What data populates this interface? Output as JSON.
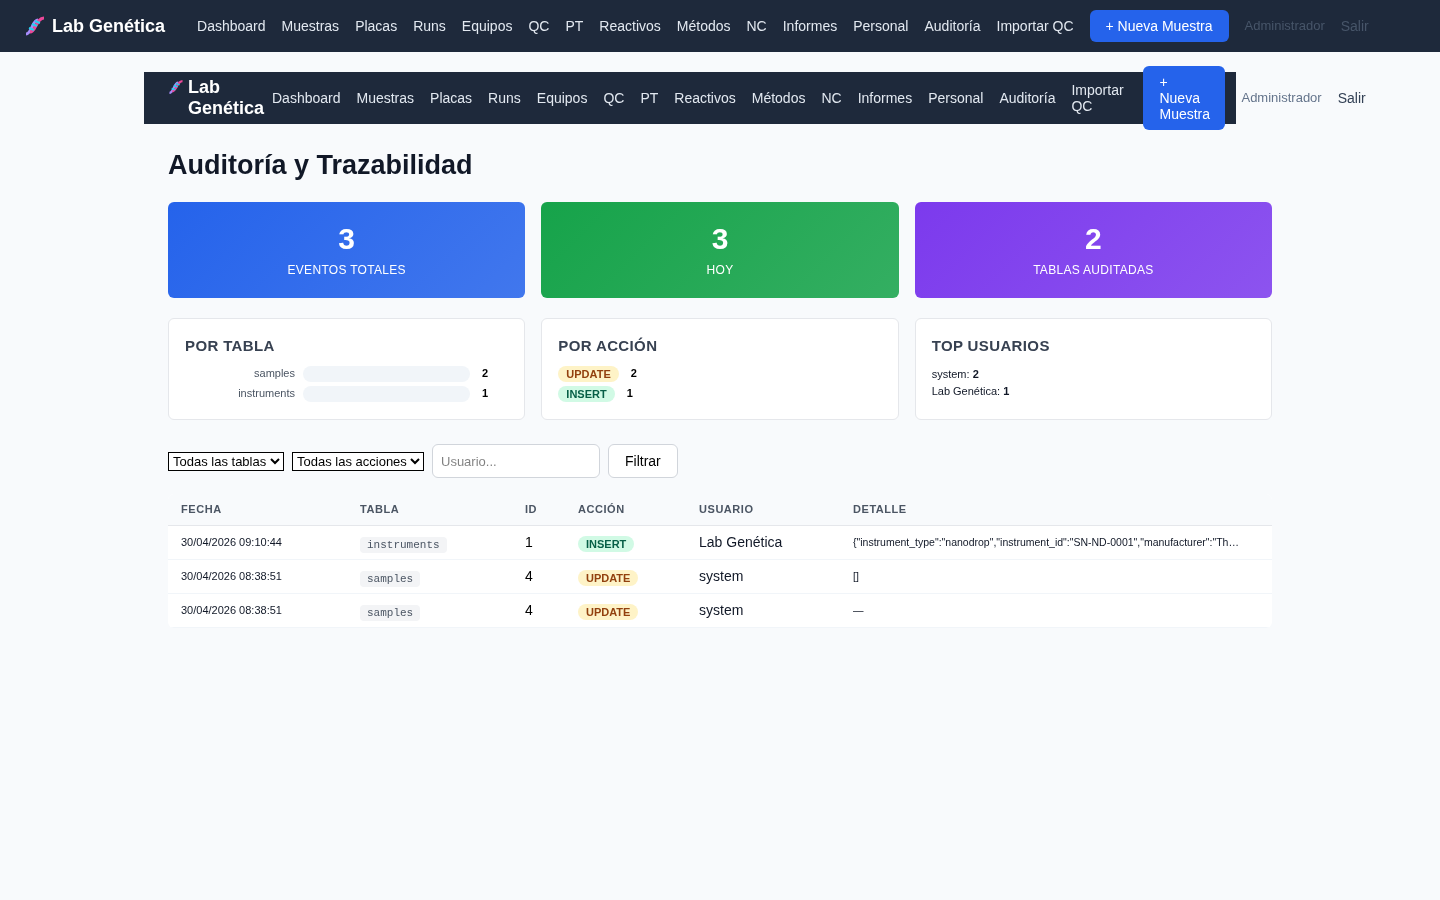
{
  "navbars": [
    {
      "kind": "full",
      "brand": "Lab Genética",
      "links": [
        "Dashboard",
        "Muestras",
        "Placas",
        "Runs",
        "Equipos",
        "QC",
        "PT",
        "Reactivos",
        "Métodos",
        "NC",
        "Informes",
        "Personal",
        "Auditoría",
        "Importar QC"
      ],
      "new_button": "+ Nueva Muestra",
      "user": "Administrador",
      "logout": "Salir"
    },
    {
      "kind": "boxed",
      "brand": "Lab Genética",
      "links": [
        "Dashboard",
        "Muestras",
        "Placas",
        "Runs",
        "Equipos",
        "QC",
        "PT",
        "Reactivos",
        "Métodos",
        "NC",
        "Informes",
        "Personal",
        "Auditoría",
        "Importar QC"
      ],
      "new_button": "+ Nueva Muestra",
      "user": "Administrador",
      "logout": "Salir"
    }
  ],
  "page_title": "Auditoría y Trazabilidad",
  "stats": [
    {
      "value": "3",
      "label": "EVENTOS TOTALES",
      "color": "#2563eb"
    },
    {
      "value": "3",
      "label": "HOY",
      "color": "#16a34a"
    },
    {
      "value": "2",
      "label": "TABLAS AUDITADAS",
      "color": "#7c3aed"
    }
  ],
  "by_table": {
    "title": "POR TABLA",
    "rows": [
      {
        "name": "samples",
        "count": "2"
      },
      {
        "name": "instruments",
        "count": "1"
      }
    ]
  },
  "by_action": {
    "title": "POR ACCIÓN",
    "rows": [
      {
        "action": "UPDATE",
        "kind": "update",
        "count": "2"
      },
      {
        "action": "INSERT",
        "kind": "insert",
        "count": "1"
      }
    ]
  },
  "top_users": {
    "title": "TOP USUARIOS",
    "rows": [
      {
        "name": "system:",
        "count": "2"
      },
      {
        "name": "Lab Genética:",
        "count": "1"
      }
    ]
  },
  "filters": {
    "table_select": "Todas las tablas",
    "action_select": "Todas las acciones",
    "user_placeholder": "Usuario...",
    "button": "Filtrar"
  },
  "table": {
    "columns": [
      "FECHA",
      "TABLA",
      "ID",
      "ACCIÓN",
      "USUARIO",
      "DETALLE"
    ],
    "rows": [
      {
        "date": "30/04/2026 09:10:44",
        "table": "instruments",
        "id": "1",
        "action": "INSERT",
        "kind": "insert",
        "user": "Lab Genética",
        "detail": "{\"instrument_type\":\"nanodrop\",\"instrument_id\":\"SN-ND-0001\",\"manufacturer\":\"Th…"
      },
      {
        "date": "30/04/2026 08:38:51",
        "table": "samples",
        "id": "4",
        "action": "UPDATE",
        "kind": "update",
        "user": "system",
        "detail": "[]"
      },
      {
        "date": "30/04/2026 08:38:51",
        "table": "samples",
        "id": "4",
        "action": "UPDATE",
        "kind": "update",
        "user": "system",
        "detail": "—"
      }
    ]
  }
}
